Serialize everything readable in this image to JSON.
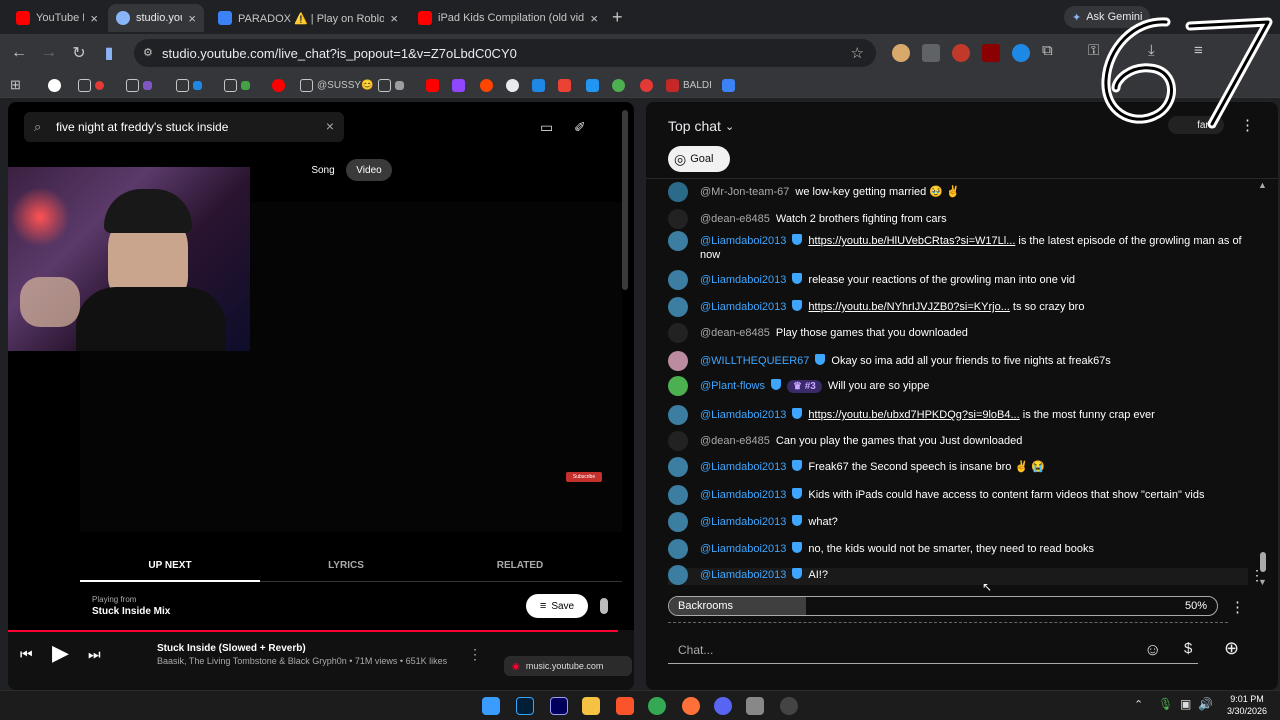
{
  "tabs": [
    {
      "title": "YouTube M",
      "color": "#ff0000"
    },
    {
      "title": "studio.you",
      "color": "#8ab4f8"
    },
    {
      "title": "PARADOX ⚠️ | Play on Roblox",
      "color": "#3b82f6"
    },
    {
      "title": "iPad Kids Compilation (old videos)",
      "color": "#ff0000"
    }
  ],
  "ask_gemini": "Ask Gemini",
  "url": "studio.youtube.com/live_chat?is_popout=1&v=Z7oLbdC0CY0",
  "bookmarks": {
    "sussy": "@SUSSY😊",
    "baldi": "BALDI"
  },
  "overlay_logo": "67",
  "music": {
    "search_value": "five night at freddy's stuck inside",
    "toggle": [
      "Song",
      "Video"
    ],
    "subscribe": "Subscribe",
    "tabs": [
      "UP NEXT",
      "LYRICS",
      "RELATED"
    ],
    "playing_from_label": "Playing from",
    "playing_from": "Stuck Inside Mix",
    "save": "Save",
    "track_title": "Stuck Inside (Slowed + Reverb)",
    "track_meta": "Baasik, The Living Tombstone & Black Gryph0n • 71M views • 651K likes",
    "popup_domain": "music.youtube.com"
  },
  "chat": {
    "header": "Top chat",
    "fans": "fans",
    "goal": "Goal",
    "messages": [
      {
        "author": "@Mr-Jon-team-67",
        "member": false,
        "text": "we low-key getting married 🥹 ✌️",
        "link": ""
      },
      {
        "author": "@dean-e8485",
        "member": false,
        "text": "Watch 2 brothers fighting from cars",
        "link": ""
      },
      {
        "author": "@Liamdaboi2013",
        "member": true,
        "link": "https://youtu.be/HlUVebCRtas?si=W17Ll...",
        "text": " is the latest episode of the growling man as of now"
      },
      {
        "author": "@Liamdaboi2013",
        "member": true,
        "text": "release your reactions of the growling man into one vid",
        "link": ""
      },
      {
        "author": "@Liamdaboi2013",
        "member": true,
        "link": "https://youtu.be/NYhrIJVJZB0?si=KYrjo...",
        "text": " ts so crazy bro"
      },
      {
        "author": "@dean-e8485",
        "member": false,
        "text": "Play those games that you downloaded",
        "link": ""
      },
      {
        "author": "@WILLTHEQUEER67",
        "member": true,
        "text": "Okay so ima add all your friends to five nights at freak67s",
        "link": ""
      },
      {
        "author": "@Plant-flows",
        "member": true,
        "rank": "#3",
        "text": "Will you are so yippe",
        "link": ""
      },
      {
        "author": "@Liamdaboi2013",
        "member": true,
        "link": "https://youtu.be/ubxd7HPKDQg?si=9loB4...",
        "text": " is the most funny crap ever"
      },
      {
        "author": "@dean-e8485",
        "member": false,
        "text": "Can you play the games that you Just downloaded",
        "link": ""
      },
      {
        "author": "@Liamdaboi2013",
        "member": true,
        "text": "Freak67 the Second speech is insane bro ✌️ 😭",
        "link": ""
      },
      {
        "author": "@Liamdaboi2013",
        "member": true,
        "text": "Kids with iPads could have access to content farm videos that show \"certain\" vids",
        "link": ""
      },
      {
        "author": "@Liamdaboi2013",
        "member": true,
        "text": "what?",
        "link": ""
      },
      {
        "author": "@Liamdaboi2013",
        "member": true,
        "text": "no, the kids would not be smarter, they need to read books",
        "link": ""
      },
      {
        "author": "@Liamdaboi2013",
        "member": true,
        "text": "AI!?",
        "link": ""
      }
    ],
    "poll": {
      "label": "Backrooms",
      "percent": "50%",
      "fraction": 0.5
    },
    "input_placeholder": "Chat..."
  },
  "taskbar": {
    "time": "9:01 PM",
    "date": "3/30/2026"
  }
}
